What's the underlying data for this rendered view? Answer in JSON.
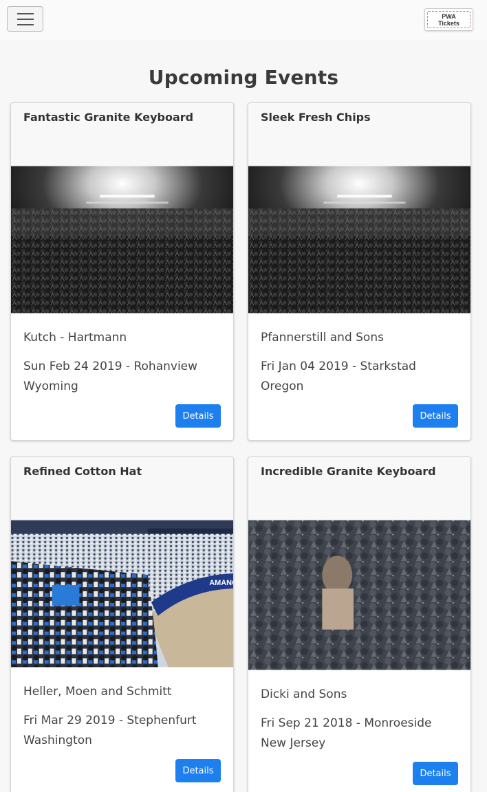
{
  "header": {
    "menu_icon": "hamburger-menu-icon",
    "logo": {
      "line1": "PWA",
      "line2": "Tickets"
    }
  },
  "page": {
    "title": "Upcoming Events"
  },
  "events": [
    {
      "title": "Fantastic Granite Keyboard",
      "venue": "Kutch - Hartmann",
      "date": "Sun Feb 24 2019 - Rohanview",
      "state": "Wyoming",
      "button": "Details",
      "image": "concert-crowd-lights"
    },
    {
      "title": "Sleek Fresh Chips",
      "venue": "Pfannerstill and Sons",
      "date": "Fri Jan 04 2019 - Starkstad",
      "state": "Oregon",
      "button": "Details",
      "image": "concert-crowd-lights"
    },
    {
      "title": "Refined Cotton Hat",
      "venue": "Heller, Moen and Schmitt",
      "date": "Fri Mar 29 2019 - Stephenfurt",
      "state": "Washington",
      "button": "Details",
      "image": "baseball-stadium-crowd",
      "image_sign": "AMANO"
    },
    {
      "title": "Incredible Granite Keyboard",
      "venue": "Dicki and Sons",
      "date": "Fri Sep 21 2018 - Monroeside",
      "state": "New Jersey",
      "button": "Details",
      "image": "festival-crowd"
    }
  ]
}
